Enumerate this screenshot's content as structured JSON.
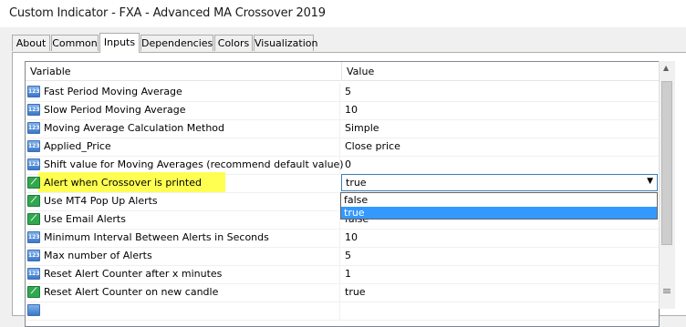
{
  "window": {
    "title": "Custom Indicator - FXA - Advanced MA Crossover 2019"
  },
  "tabs": [
    {
      "label": "About"
    },
    {
      "label": "Common"
    },
    {
      "label": "Inputs"
    },
    {
      "label": "Dependencies"
    },
    {
      "label": "Colors"
    },
    {
      "label": "Visualization"
    }
  ],
  "active_tab": "Inputs",
  "grid": {
    "headers": {
      "variable": "Variable",
      "value": "Value"
    },
    "rows": [
      {
        "icon": "number-icon",
        "icon_text": "123",
        "name": "Fast Period Moving Average",
        "value": "5"
      },
      {
        "icon": "number-icon",
        "icon_text": "123",
        "name": "Slow Period Moving Average",
        "value": "10"
      },
      {
        "icon": "number-icon",
        "icon_text": "123",
        "name": "Moving Average Calculation Method",
        "value": "Simple"
      },
      {
        "icon": "number-icon",
        "icon_text": "123",
        "name": "Applied_Price",
        "value": "Close price"
      },
      {
        "icon": "number-icon",
        "icon_text": "123",
        "name": "Shift value for Moving Averages (recommend default value)",
        "value": "0"
      },
      {
        "icon": "boolean-icon",
        "icon_text": "",
        "name": "Alert when Crossover is printed",
        "value": "true"
      },
      {
        "icon": "boolean-icon",
        "icon_text": "",
        "name": "Use MT4 Pop Up Alerts",
        "value": ""
      },
      {
        "icon": "boolean-icon",
        "icon_text": "",
        "name": "Use Email Alerts",
        "value": "false"
      },
      {
        "icon": "number-icon",
        "icon_text": "123",
        "name": "Minimum Interval Between Alerts in Seconds",
        "value": "10"
      },
      {
        "icon": "number-icon",
        "icon_text": "123",
        "name": "Max number of Alerts",
        "value": "5"
      },
      {
        "icon": "number-icon",
        "icon_text": "123",
        "name": "Reset Alert Counter after x minutes",
        "value": "1"
      },
      {
        "icon": "boolean-icon",
        "icon_text": "",
        "name": "Reset Alert Counter on new candle",
        "value": "true"
      },
      {
        "icon": "number-icon",
        "icon_text": "",
        "name": "",
        "value": ""
      }
    ]
  },
  "dropdown": {
    "selected": "true",
    "options": [
      "false",
      "true"
    ]
  },
  "colors": {
    "highlight": "#ffff33",
    "selection": "#3399ff"
  }
}
